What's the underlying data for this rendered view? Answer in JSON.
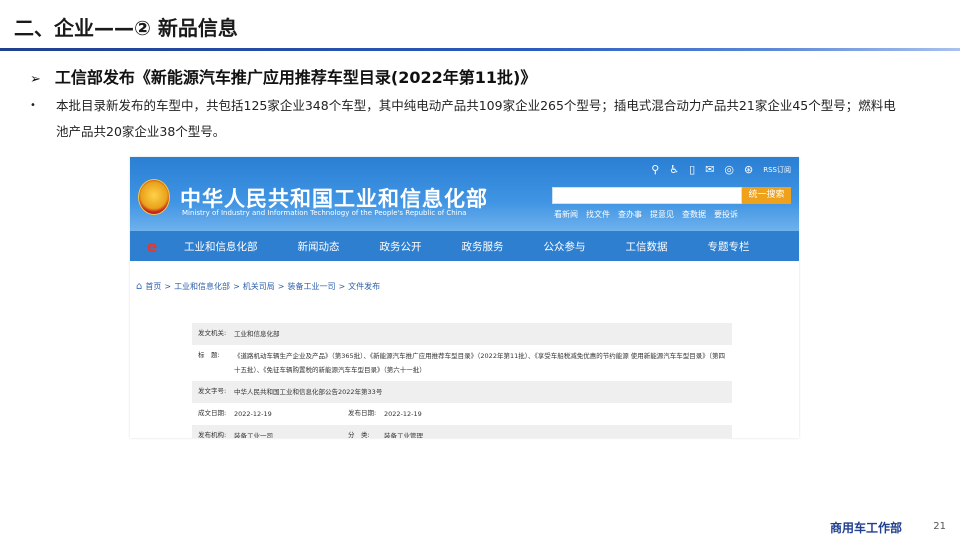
{
  "slide": {
    "title": "二、企业——② 新品信息",
    "subhead": "工信部发布《新能源汽车推广应用推荐车型目录(2022年第11批)》",
    "bullet_text": "本批目录新发布的车型中，共包括125家企业348个车型，其中纯电动产品共109家企业265个型号；插电式混合动力产品共21家企业45个型号；燃料电池产品共20家企业38个型号。",
    "footer_brand": "商用车工作部",
    "page_number": "21"
  },
  "site": {
    "name_cn": "中华人民共和国工业和信息化部",
    "name_en": "Ministry of Industry and Information Technology of the People's Republic of China",
    "rss_label": "RSS订阅",
    "search_button": "统一搜索",
    "quick_links": [
      "看新闻",
      "找文件",
      "查办事",
      "提意见",
      "查数据",
      "要投诉"
    ],
    "nav": [
      "工业和信息化部",
      "新闻动态",
      "政务公开",
      "政务服务",
      "公众参与",
      "工信数据",
      "专题专栏"
    ],
    "breadcrumb": [
      "首页",
      "工业和信息化部",
      "机关司局",
      "装备工业一司",
      "文件发布"
    ],
    "doc": {
      "issuer_label": "发文机关:",
      "issuer": "工业和信息化部",
      "title_label": "标　题:",
      "title": "《道路机动车辆生产企业及产品》（第365批）、《新能源汽车推广应用推荐车型目录》（2022年第11批）、《享受车船税减免优惠的节约能源 使用新能源汽车车型目录》（第四十五批）、《免征车辆购置税的新能源汽车车型目录》（第六十一批）",
      "docno_label": "发文字号:",
      "docno": "中华人民共和国工业和信息化部公告2022年第33号",
      "created_label": "成文日期:",
      "created": "2022-12-19",
      "published_label": "发布日期:",
      "published": "2022-12-19",
      "org_label": "发布机构:",
      "org": "装备工业一司",
      "category_label": "分　类:",
      "category": "装备工业管理"
    }
  }
}
